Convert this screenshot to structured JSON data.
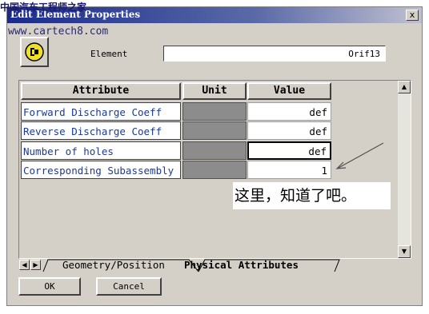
{
  "watermark": {
    "site_name": "中国汽车工程师之家",
    "url": "www.cartech8.com"
  },
  "window": {
    "title": "Edit Element Properties",
    "close_label": "x"
  },
  "element": {
    "label": "Element",
    "value": "Orif13",
    "icon": "orifice-element-icon"
  },
  "table": {
    "headers": {
      "attribute": "Attribute",
      "unit": "Unit",
      "value": "Value"
    },
    "rows": [
      {
        "attribute": "Forward Discharge Coeff",
        "unit": "",
        "value": "def"
      },
      {
        "attribute": "Reverse Discharge Coeff",
        "unit": "",
        "value": "def"
      },
      {
        "attribute": "Number of holes",
        "unit": "",
        "value": "def"
      },
      {
        "attribute": "Corresponding Subassembly",
        "unit": "",
        "value": "1"
      }
    ]
  },
  "annotation": {
    "text": "这里，知道了吧。"
  },
  "tabs": [
    {
      "label": "Geometry/Position",
      "active": false
    },
    {
      "label": "Physical Attributes",
      "active": true
    }
  ],
  "buttons": {
    "ok": "OK",
    "cancel": "Cancel"
  },
  "colors": {
    "title_start": "#1a2a8c",
    "label_text": "#1a3a9a",
    "unit_cell": "#8c8c8c",
    "window_bg": "#d4d0c8"
  }
}
